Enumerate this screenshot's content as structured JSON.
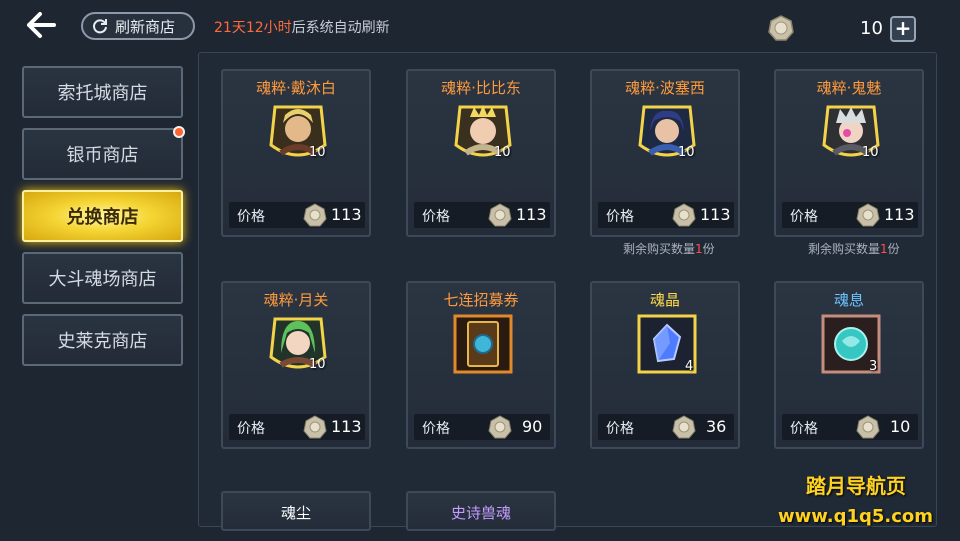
{
  "header": {
    "refresh_label": "刷新商店",
    "timer_highlight": "21天12小时",
    "timer_rest": "后系统自动刷新",
    "currency_amount": "10",
    "plus": "+"
  },
  "sidebar": {
    "items": [
      {
        "label": "索托城商店"
      },
      {
        "label": "银币商店"
      },
      {
        "label": "兑换商店"
      },
      {
        "label": "大斗魂场商店"
      },
      {
        "label": "史莱克商店"
      }
    ]
  },
  "shop": {
    "price_label": "价格",
    "remain_prefix": "剩余购买数量",
    "remain_suffix": "份",
    "items": [
      {
        "title": "魂粹·戴沐白",
        "count": "10",
        "price": "113"
      },
      {
        "title": "魂粹·比比东",
        "count": "10",
        "price": "113"
      },
      {
        "title": "魂粹·波塞西",
        "count": "10",
        "price": "113",
        "remain": "1"
      },
      {
        "title": "魂粹·鬼魅",
        "count": "10",
        "price": "113",
        "remain": "1"
      },
      {
        "title": "魂粹·月关",
        "count": "10",
        "price": "113"
      },
      {
        "title": "七连招募券",
        "count": "",
        "price": "90"
      },
      {
        "title": "魂晶",
        "count": "4",
        "price": "36"
      },
      {
        "title": "魂息",
        "count": "3",
        "price": "10"
      },
      {
        "title": "魂尘"
      },
      {
        "title": "史诗兽魂"
      }
    ]
  },
  "watermark": {
    "line1": "踏月导航页",
    "line2": "www.q1q5.com"
  }
}
